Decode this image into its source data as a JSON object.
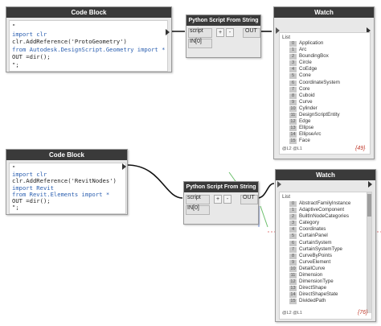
{
  "node1": {
    "title": "Code Block",
    "code": [
      "\"",
      "import clr",
      "clr.AddReference('ProtoGeometry')",
      "from Autodesk.DesignScript.Geometry import *",
      "OUT =dir();",
      "\";"
    ]
  },
  "node2": {
    "title": "Python Script From String",
    "port_in_1": "script",
    "port_in_2": "IN[0]",
    "port_out": "OUT",
    "plus": "+",
    "minus": "-"
  },
  "watch1": {
    "title": "Watch",
    "list_label": "List",
    "items": [
      "Application",
      "Arc",
      "BoundingBox",
      "Circle",
      "CoEdge",
      "Cone",
      "CoordinateSystem",
      "Core",
      "Cuboid",
      "Curve",
      "Cylinder",
      "DesignScriptEntity",
      "Edge",
      "Ellipse",
      "EllipseArc",
      "Face"
    ],
    "footer": "@L2 @L1",
    "count": "{49}"
  },
  "node3": {
    "title": "Code Block",
    "code": [
      "\"",
      "import clr",
      "clr.AddReference('RevitNodes')",
      "import Revit",
      "from Revit.Elements import *",
      "OUT =dir();",
      "\";"
    ]
  },
  "node4": {
    "title": "Python Script From String",
    "port_in_1": "script",
    "port_in_2": "IN[0]",
    "port_out": "OUT",
    "plus": "+",
    "minus": "-"
  },
  "watch2": {
    "title": "Watch",
    "list_label": "List",
    "items": [
      "AbstractFamilyInstance",
      "AdaptiveComponent",
      "BuiltInNodeCategories",
      "Category",
      "Coordinates",
      "CurtainPanel",
      "CurtainSystem",
      "CurtainSystemType",
      "CurveByPoints",
      "CurveElement",
      "DetailCurve",
      "Dimension",
      "DimensionType",
      "DirectShape",
      "DirectShapeState",
      "DividedPath"
    ],
    "footer": "@L2 @L1",
    "count": "{76}"
  },
  "colors": {
    "header": "#3a3a3a",
    "node_body": "#e8e8e8",
    "wire": "#111111",
    "count_text": "#c0392b",
    "keyword": "#2b5fb0",
    "string": "#a03b6a"
  }
}
